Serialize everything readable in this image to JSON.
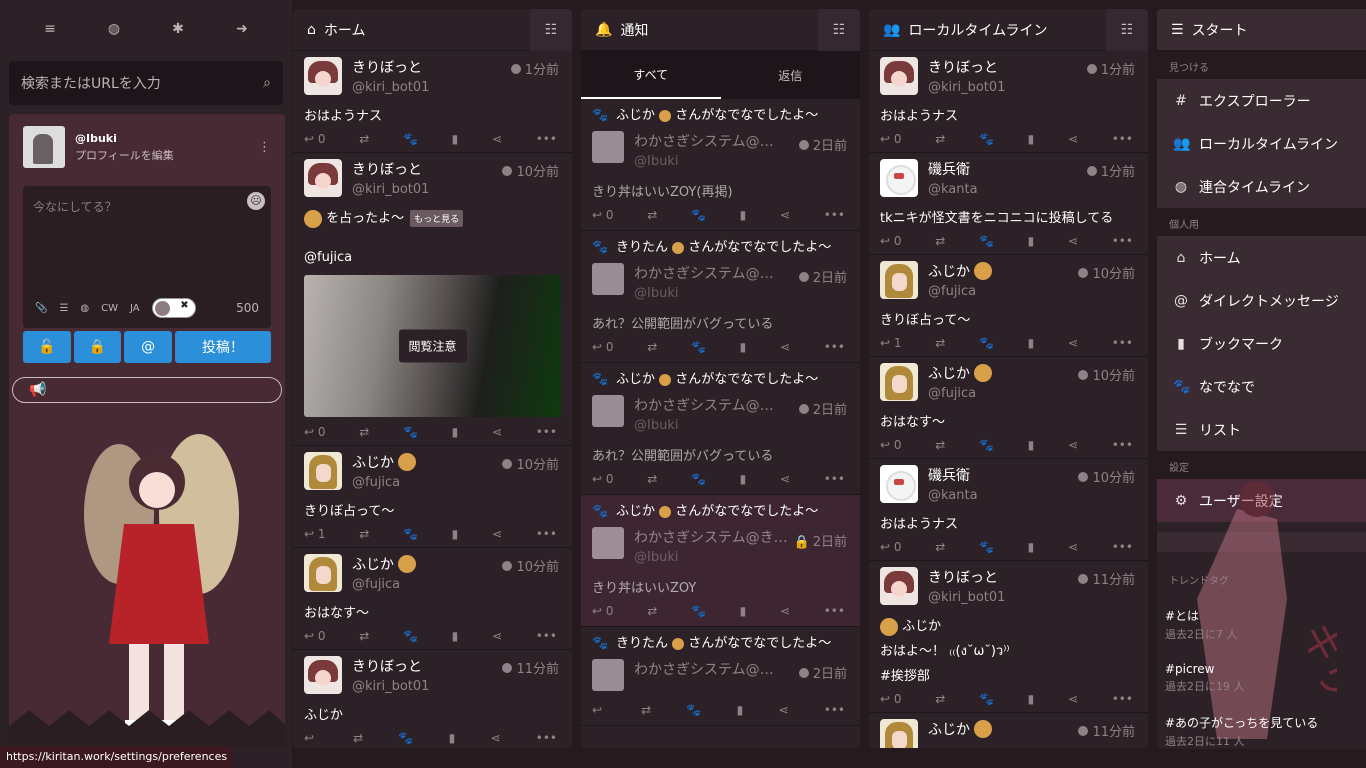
{
  "compose": {
    "search_placeholder": "検索またはURLを入力",
    "account_name": "@Ibuki",
    "edit_profile": "プロフィールを編集",
    "textarea_placeholder": "今なにしてる？",
    "cw": "CW",
    "lang": "JA",
    "char_count": "500",
    "post_button": "投稿！",
    "mention_button": "@"
  },
  "columns": {
    "home": {
      "title": "ホーム",
      "statuses": [
        {
          "name": "きりぼっと",
          "user": "@kiri_bot01",
          "time": "1分前",
          "body": "おはようナス",
          "replies": "0",
          "avatar": "kiri"
        },
        {
          "name": "きりぼっと",
          "user": "@kiri_bot01",
          "time": "10分前",
          "body": "を占ったよ〜",
          "more": "もっと見る",
          "mention": "@fujica",
          "media_warning": "閲覧注意",
          "replies": "0",
          "avatar": "kiri"
        },
        {
          "name": "ふじか",
          "user": "@fujica",
          "time": "10分前",
          "body": "きりぼ占って〜",
          "replies": "1",
          "avatar": "fuji"
        },
        {
          "name": "ふじか",
          "user": "@fujica",
          "time": "10分前",
          "body": "おはなす〜",
          "replies": "0",
          "avatar": "fuji"
        },
        {
          "name": "きりぼっと",
          "user": "@kiri_bot01",
          "time": "11分前",
          "body": "ふじか",
          "replies": "",
          "avatar": "kiri"
        }
      ]
    },
    "notifications": {
      "title": "通知",
      "tab_all": "すべて",
      "tab_replies": "返信",
      "items": [
        {
          "head": "ふじか",
          "action": "さんがなでなでしたよ〜",
          "name": "わかさぎシステム@…",
          "user": "@Ibuki",
          "time": "2日前",
          "body": "きり丼はいいZOY(再掲)",
          "replies": "0"
        },
        {
          "head": "きりたん",
          "action": "さんがなでなでしたよ〜",
          "name": "わかさぎシステム@…",
          "user": "@Ibuki",
          "time": "2日前",
          "body": "あれ？公開範囲がバグっている",
          "replies": "0"
        },
        {
          "head": "ふじか",
          "action": "さんがなでなでしたよ〜",
          "name": "わかさぎシステム@…",
          "user": "@Ibuki",
          "time": "2日前",
          "body": "あれ？公開範囲がバグっている",
          "replies": "0"
        },
        {
          "head": "ふじか",
          "action": "さんがなでなでしたよ〜",
          "name": "わかさぎシステム@き…",
          "user": "@Ibuki",
          "time": "2日前",
          "body": "きり丼はいいZOY",
          "replies": "0"
        },
        {
          "head": "きりたん",
          "action": "さんがなでなでしたよ〜",
          "name": "わかさぎシステム@…",
          "user": "",
          "time": "2日前",
          "body": "",
          "replies": ""
        }
      ]
    },
    "local": {
      "title": "ローカルタイムライン",
      "statuses": [
        {
          "name": "きりぼっと",
          "user": "@kiri_bot01",
          "time": "1分前",
          "body": "おはようナス",
          "replies": "0",
          "avatar": "kiri"
        },
        {
          "name": "磯兵衛",
          "user": "@kanta",
          "time": "1分前",
          "body": "tkニキが怪文書をニコニコに投稿してる",
          "replies": "0",
          "avatar": "iso"
        },
        {
          "name": "ふじか",
          "user": "@fujica",
          "time": "10分前",
          "body": "きりぼ占って〜",
          "replies": "1",
          "avatar": "fuji"
        },
        {
          "name": "ふじか",
          "user": "@fujica",
          "time": "10分前",
          "body": "おはなす〜",
          "replies": "0",
          "avatar": "fuji"
        },
        {
          "name": "磯兵衛",
          "user": "@kanta",
          "time": "10分前",
          "body": "おはようナス",
          "replies": "0",
          "avatar": "iso"
        },
        {
          "name": "きりぼっと",
          "user": "@kiri_bot01",
          "time": "11分前",
          "body": "ふじか",
          "body2": "おはよ〜！ ₍₍(ง˘ω˘)ว⁾⁾",
          "body3": "#挨拶部",
          "replies": "0",
          "avatar": "kiri"
        },
        {
          "name": "ふじか",
          "user": "",
          "time": "11分前",
          "body": "",
          "replies": "",
          "avatar": "fuji"
        }
      ]
    }
  },
  "nav": {
    "title": "スタート",
    "sec_discover": "見つける",
    "explorer": "エクスプローラー",
    "local": "ローカルタイムライン",
    "federated": "連合タイムライン",
    "sec_personal": "個人用",
    "home": "ホーム",
    "dm": "ダイレクトメッセージ",
    "bookmarks": "ブックマーク",
    "nadenade": "なでなで",
    "lists": "リスト",
    "sec_settings": "設定",
    "user_settings": "ユーザー設定",
    "trends_title": "トレンドタグ",
    "trends": [
      {
        "tag": "#とは",
        "count": "過去2日に7 人"
      },
      {
        "tag": "#picrew",
        "count": "過去2日に19 人"
      },
      {
        "tag": "#あの子がこっちを見ている",
        "count": "過去2日に11 人"
      }
    ]
  },
  "statusbar_url": "https://kiritan.work/settings/preferences",
  "colors": {
    "accent": "#2b90d9",
    "paw": "#e8642c",
    "bg": "#251b1f",
    "column": "#2c2126"
  }
}
